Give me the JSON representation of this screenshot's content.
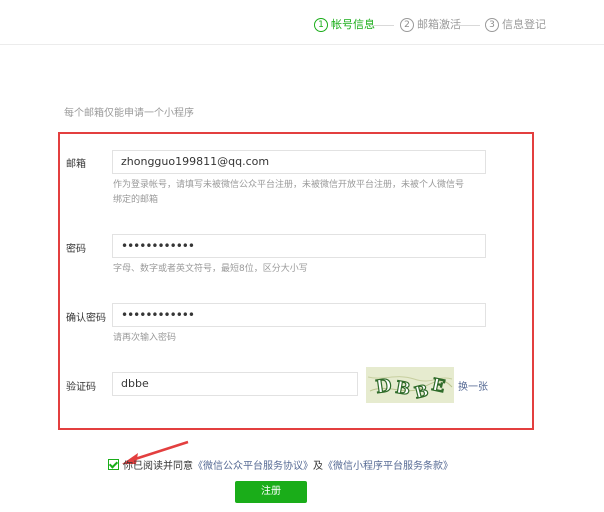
{
  "steps": [
    {
      "num": "1",
      "label": "帐号信息",
      "state": "active"
    },
    {
      "num": "2",
      "label": "邮箱激活",
      "state": "inactive"
    },
    {
      "num": "3",
      "label": "信息登记",
      "state": "inactive"
    }
  ],
  "form": {
    "hint": "每个邮箱仅能申请一个小程序",
    "email": {
      "label": "邮箱",
      "value": "zhongguo199811@qq.com",
      "tip_line1": "作为登录帐号，请填写未被微信公众平台注册，未被微信开放平台注册，未被个人微信号",
      "tip_line2": "绑定的邮箱"
    },
    "password": {
      "label": "密码",
      "value": "••••••••••••",
      "tip": "字母、数字或者英文符号，最短8位，区分大小写"
    },
    "confirm": {
      "label": "确认密码",
      "value": "••••••••••••",
      "tip": "请再次输入密码"
    },
    "captcha": {
      "label": "验证码",
      "value": "dbbe",
      "image_text": "DBBE",
      "refresh": "换一张"
    }
  },
  "agreement": {
    "prefix": "你已阅读并同意",
    "link1": "《微信公众平台服务协议》",
    "middle": "及",
    "link2": "《微信小程序平台服务条款》",
    "checked": true
  },
  "register_button": "注册",
  "colors": {
    "accent": "#1aad19",
    "highlight": "#e33f3f",
    "link": "#576b95"
  }
}
